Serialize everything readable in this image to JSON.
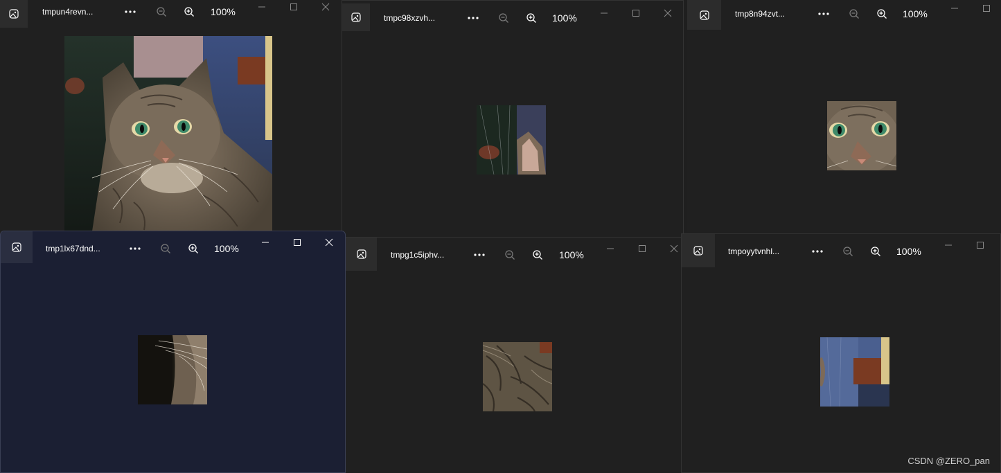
{
  "windows": [
    {
      "title": "tmpun4revn...",
      "zoom": "100%"
    },
    {
      "title": "tmpc98xzvh...",
      "zoom": "100%"
    },
    {
      "title": "tmp8n94zvt...",
      "zoom": "100%"
    },
    {
      "title": "tmp1lx67dnd...",
      "zoom": "100%"
    },
    {
      "title": "tmpg1c5iphv...",
      "zoom": "100%"
    },
    {
      "title": "tmpoyytvnhl...",
      "zoom": "100%"
    }
  ],
  "icons": {
    "app": "photo-icon",
    "more": "more-dots-icon",
    "zoom_out": "zoom-out-icon",
    "zoom_in": "zoom-in-icon",
    "minimize": "minimize-icon",
    "maximize": "maximize-icon",
    "close": "close-icon"
  },
  "colors": {
    "window_bg": "#202020",
    "active_window_bg": "#1b1f33",
    "text": "#ffffff"
  },
  "watermark": "CSDN @ZERO_pan"
}
